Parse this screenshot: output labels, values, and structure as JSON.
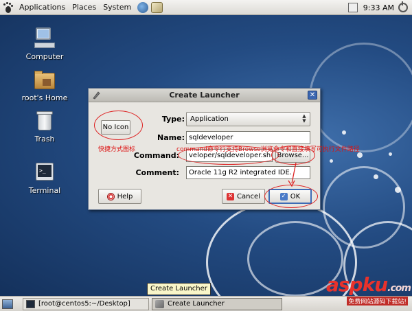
{
  "top_panel": {
    "menus": [
      "Applications",
      "Places",
      "System"
    ],
    "clock": "9:33 AM"
  },
  "desktop": {
    "icons": [
      {
        "label": "Computer"
      },
      {
        "label": "root's Home"
      },
      {
        "label": "Trash"
      },
      {
        "label": "Terminal"
      }
    ]
  },
  "dialog": {
    "title": "Create Launcher",
    "close_glyph": "✕",
    "icon_button": "No Icon",
    "type_label": "Type:",
    "type_value": "Application",
    "name_label": "Name:",
    "name_value": "sqldeveloper",
    "command_label": "Command:",
    "command_value": "veloper/sqldeveloper.sh",
    "browse_button": "Browse...",
    "comment_label": "Comment:",
    "comment_value": "Oracle 11g R2 integrated IDE.",
    "help_button": "Help",
    "cancel_button": "Cancel",
    "ok_button": "OK"
  },
  "annotations": {
    "shortcut_icon": "快捷方式图标",
    "command_note": "command命令行支持Browse浏览命令和直接填写可执行文件路径"
  },
  "tooltip": "Create Launcher",
  "taskbar": {
    "tasks": [
      {
        "label": "[root@centos5:~/Desktop]"
      },
      {
        "label": "Create Launcher"
      }
    ]
  },
  "watermark": {
    "main": "aspku",
    "suffix": ".com",
    "sub": "免费网站源码下载站!"
  },
  "colors": {
    "desktop": "#234b82",
    "annotation": "#dd2222",
    "titlebar_close": "#3b66b0"
  }
}
